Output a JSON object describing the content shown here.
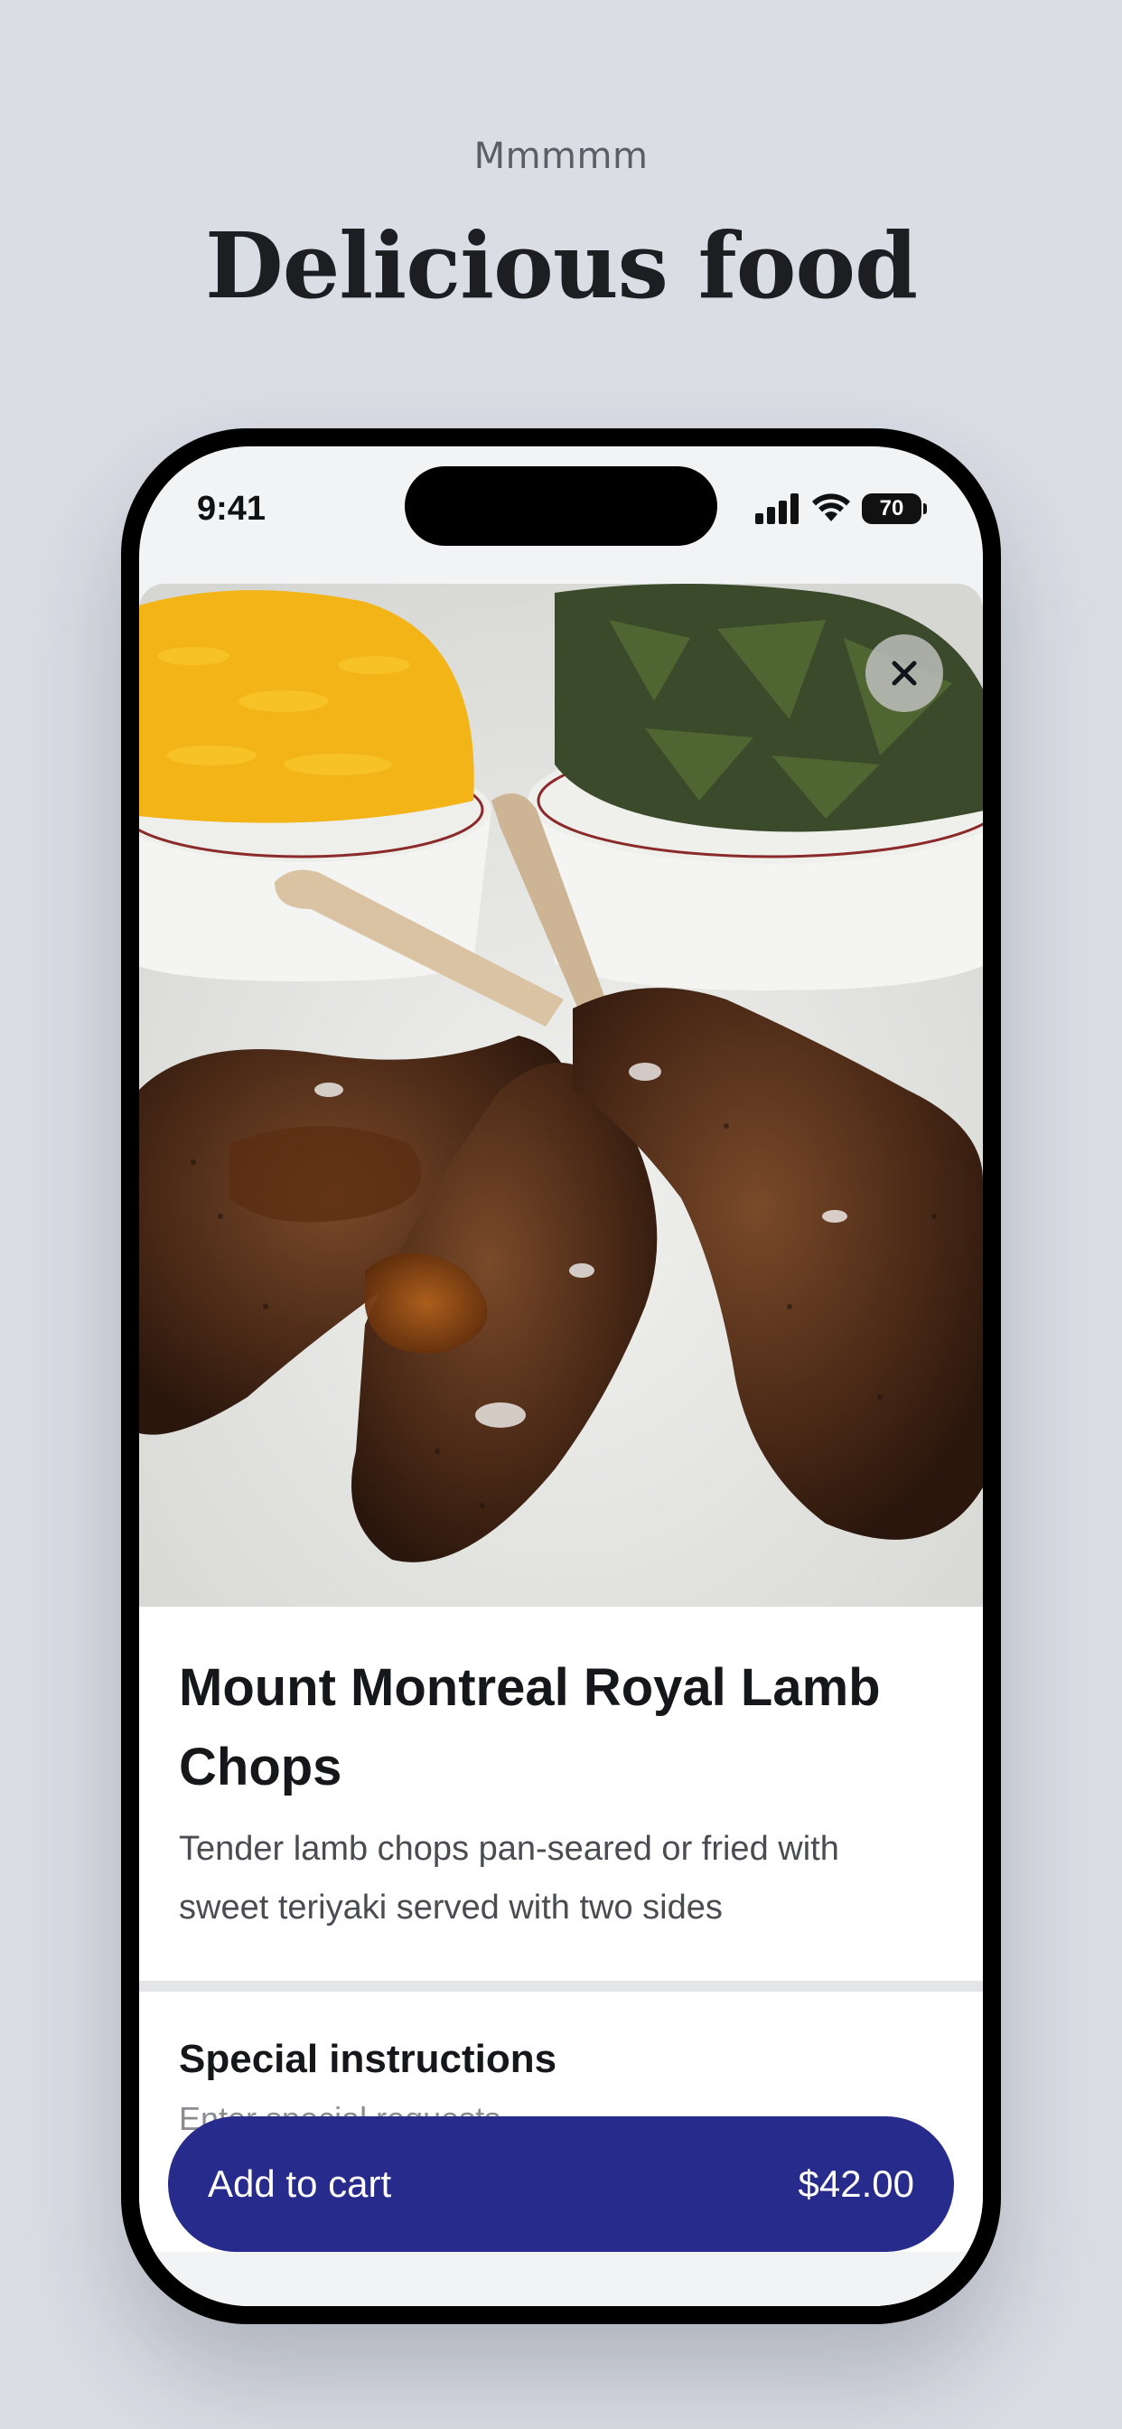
{
  "header": {
    "eyebrow": "Mmmmm",
    "headline": "Delicious food"
  },
  "status_bar": {
    "time": "9:41",
    "battery": "70",
    "icons": [
      "signal-icon",
      "wifi-icon",
      "battery-icon"
    ]
  },
  "item": {
    "image_alt": "Lamb chops glazed with teriyaki with bowls of yellow rice and collard greens",
    "title": "Mount Montreal Royal Lamb Chops",
    "description": "Tender lamb chops pan-seared or fried with sweet teriyaki served with two sides"
  },
  "special_instructions": {
    "heading": "Special instructions",
    "placeholder": "Enter special requests"
  },
  "cart_button": {
    "label": "Add to cart",
    "price": "$42.00"
  },
  "colors": {
    "background": "#dadde4",
    "accent": "#272b8c",
    "text": "#16171b"
  }
}
